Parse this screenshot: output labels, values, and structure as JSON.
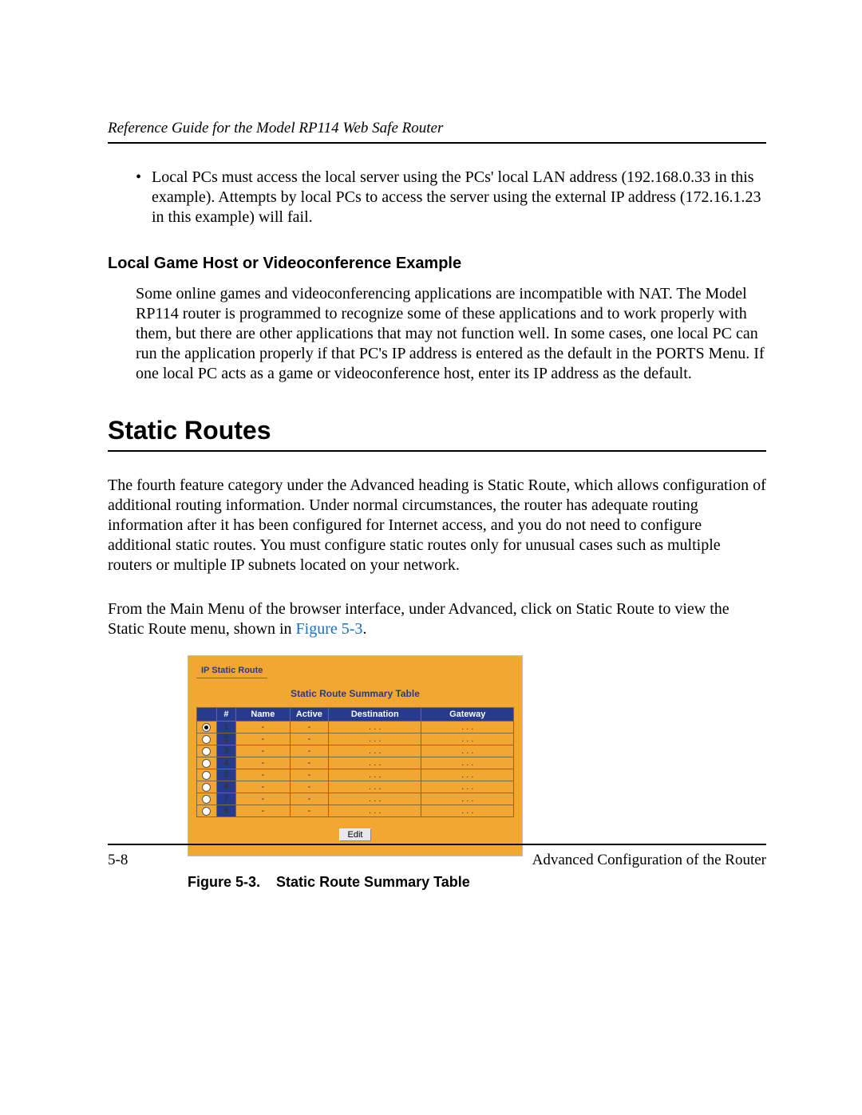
{
  "header": {
    "running": "Reference Guide for the Model RP114 Web Safe Router"
  },
  "bullet1": "Local PCs must access the local server using the PCs' local LAN address (192.168.0.33 in this example). Attempts by local PCs to access the server using the external IP address (172.16.1.23 in this example) will fail.",
  "subhead": "Local Game Host or Videoconference Example",
  "para_game": "Some online games and videoconferencing applications are incompatible with NAT. The Model RP114 router is programmed to recognize some of these applications and to work properly with them, but there are other applications that may not function well. In some cases, one local PC can run the application properly if that PC's IP address is entered as the default in the PORTS Menu. If one local PC acts as a game or videoconference host, enter its IP address as the default.",
  "h1": "Static Routes",
  "para_sr1": "The fourth feature category under the Advanced heading is Static Route, which allows configuration of additional routing information. Under normal circumstances, the router has adequate routing information after it has been configured for Internet access, and you do not need to configure additional static routes. You must configure static routes only for unusual cases such as multiple routers or multiple IP subnets located on your network.",
  "para_sr2_a": "From the Main Menu of the browser interface, under Advanced, click on Static Route to view the Static Route menu, shown in ",
  "para_sr2_link": "Figure 5-3",
  "para_sr2_b": ".",
  "panel": {
    "tab": "IP Static Route",
    "title": "Static Route Summary Table",
    "cols": {
      "num": "#",
      "name": "Name",
      "active": "Active",
      "dest": "Destination",
      "gw": "Gateway"
    },
    "rows": [
      {
        "n": "1",
        "name": "-",
        "active": "-",
        "dest": ". . .",
        "gw": ". . .",
        "sel": true
      },
      {
        "n": "2",
        "name": "-",
        "active": "-",
        "dest": ". . .",
        "gw": ". . .",
        "sel": false
      },
      {
        "n": "3",
        "name": "-",
        "active": "-",
        "dest": ". . .",
        "gw": ". . .",
        "sel": false
      },
      {
        "n": "4",
        "name": "-",
        "active": "-",
        "dest": ". . .",
        "gw": ". . .",
        "sel": false
      },
      {
        "n": "5",
        "name": "-",
        "active": "-",
        "dest": ". . .",
        "gw": ". . .",
        "sel": false
      },
      {
        "n": "6",
        "name": "-",
        "active": "-",
        "dest": ". . .",
        "gw": ". . .",
        "sel": false
      },
      {
        "n": "7",
        "name": "-",
        "active": "-",
        "dest": ". . .",
        "gw": ". . .",
        "sel": false
      },
      {
        "n": "8",
        "name": "-",
        "active": "-",
        "dest": ". . .",
        "gw": ". . .",
        "sel": false
      }
    ],
    "edit": "Edit"
  },
  "fig_caption_a": "Figure 5-3.",
  "fig_caption_b": "Static Route Summary Table",
  "footer": {
    "left": "5-8",
    "right": "Advanced Configuration of the Router"
  }
}
